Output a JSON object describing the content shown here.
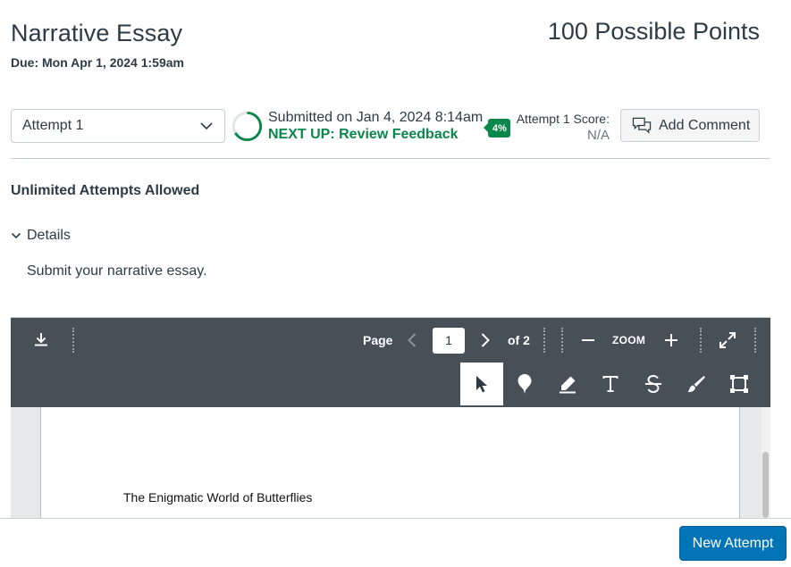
{
  "header": {
    "title": "Narrative Essay",
    "due": "Due: Mon Apr 1, 2024 1:59am",
    "points": "100 Possible Points"
  },
  "submission": {
    "attempt_selected": "Attempt 1",
    "submitted_text": "Submitted on Jan 4, 2024 8:14am",
    "next_up": "NEXT UP: Review Feedback",
    "badge": "4%",
    "score_label": "Attempt 1 Score:",
    "score_value": "N/A",
    "add_comment_label": "Add Comment"
  },
  "attempts_info": "Unlimited Attempts Allowed",
  "details": {
    "toggle_label": "Details",
    "text": "Submit your narrative essay."
  },
  "viewer": {
    "page_label": "Page",
    "current_page": "1",
    "of_pages": "of 2",
    "zoom_label": "ZOOM",
    "doc_heading": "The Enigmatic World of Butterflies",
    "tools": [
      "select-tool",
      "point-annotation-tool",
      "highlight-tool",
      "text-tool",
      "strikeout-tool",
      "freedraw-tool",
      "area-tool"
    ]
  },
  "footer": {
    "new_attempt_label": "New Attempt"
  },
  "colors": {
    "accent_green": "#0b874b",
    "primary_blue": "#0374b5",
    "toolbar_bg": "#474f57",
    "text": "#2d3b45"
  }
}
